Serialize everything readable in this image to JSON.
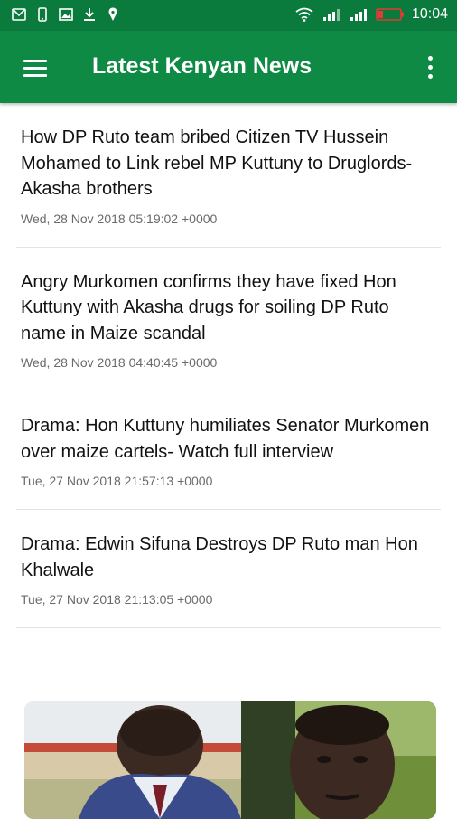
{
  "status_bar": {
    "time": "10:04",
    "left_icons": [
      "gmail-icon",
      "phone-icon",
      "image-icon",
      "download-icon",
      "location-icon"
    ],
    "right_icons": [
      "wifi-icon",
      "signal-icon",
      "signal-icon",
      "battery-low-icon"
    ],
    "battery_color": "#e53935"
  },
  "app_bar": {
    "title": "Latest Kenyan News",
    "color": "#0f8a45"
  },
  "articles": [
    {
      "title": "How DP Ruto team bribed Citizen TV Hussein Mohamed to Link rebel MP Kuttuny to Druglords-Akasha brothers",
      "date": "Wed, 28 Nov 2018 05:19:02 +0000"
    },
    {
      "title": "Angry Murkomen confirms they have fixed Hon Kuttuny with Akasha drugs for soiling DP Ruto name in Maize scandal",
      "date": "Wed, 28 Nov 2018 04:40:45 +0000"
    },
    {
      "title": "Drama: Hon Kuttuny humiliates Senator Murkomen over maize cartels- Watch full interview",
      "date": "Tue, 27 Nov 2018 21:57:13 +0000"
    },
    {
      "title": "Drama: Edwin Sifuna Destroys DP Ruto man Hon Khalwale",
      "date": "Tue, 27 Nov 2018 21:13:05 +0000"
    }
  ]
}
